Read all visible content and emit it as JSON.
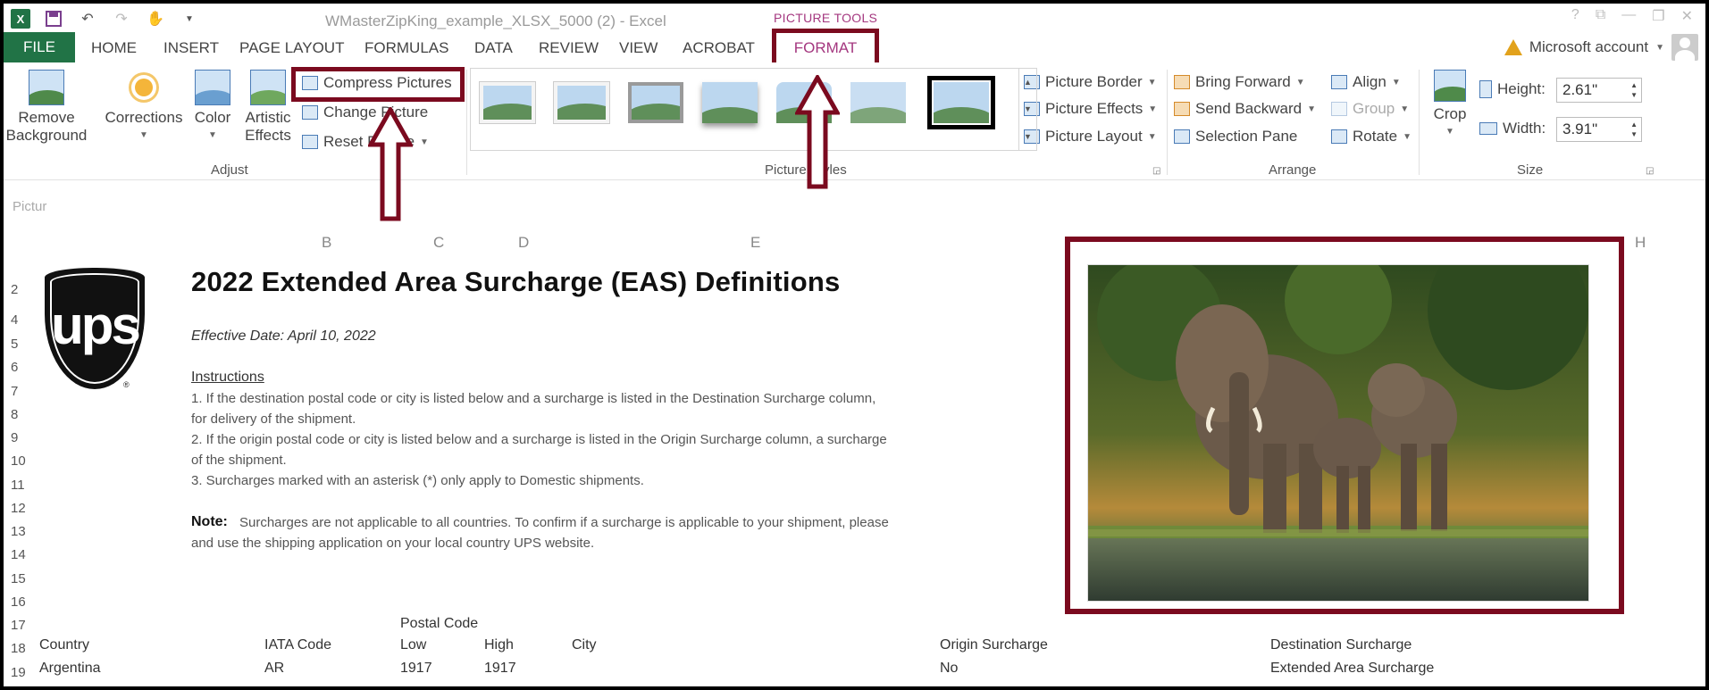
{
  "titlebar": {
    "app_icon": "excel-icon",
    "document_title": "WMasterZipKing_example_XLSX_5000 (2) - Excel",
    "context_title": "PICTURE TOOLS",
    "qat": [
      "save-icon",
      "undo-icon",
      "redo-icon",
      "touch-mode-icon",
      "customize-icon"
    ],
    "window": [
      "help-icon",
      "ribbon-display-icon",
      "minimize-icon",
      "restore-icon",
      "close-icon"
    ]
  },
  "tabs": {
    "file": "FILE",
    "items": [
      "HOME",
      "INSERT",
      "PAGE LAYOUT",
      "FORMULAS",
      "DATA",
      "REVIEW",
      "VIEW",
      "ACROBAT"
    ],
    "active": "FORMAT",
    "account": "Microsoft account"
  },
  "ribbon": {
    "adjust": {
      "label": "Adjust",
      "remove_background_1": "Remove",
      "remove_background_2": "Background",
      "corrections": "Corrections",
      "color": "Color",
      "artistic_1": "Artistic",
      "artistic_2": "Effects",
      "compress": "Compress Pictures",
      "change": "Change Picture",
      "reset": "Reset Picture"
    },
    "styles": {
      "label": "Picture Styles",
      "border": "Picture Border",
      "effects": "Picture Effects",
      "layout": "Picture Layout"
    },
    "arrange": {
      "label": "Arrange",
      "bring_forward": "Bring Forward",
      "send_backward": "Send Backward",
      "selection_pane": "Selection Pane",
      "align": "Align",
      "group": "Group",
      "rotate": "Rotate"
    },
    "size": {
      "label": "Size",
      "crop": "Crop",
      "height_label": "Height:",
      "height_value": "2.61\"",
      "width_label": "Width:",
      "width_value": "3.91\""
    }
  },
  "sheet": {
    "name_box": "Pictur",
    "columns": [
      "B",
      "C",
      "D",
      "E",
      "H"
    ],
    "rows": [
      "2",
      "4",
      "5",
      "6",
      "7",
      "8",
      "9",
      "10",
      "11",
      "12",
      "13",
      "14",
      "15",
      "16",
      "17",
      "18",
      "19"
    ],
    "heading": "2022 Extended Area Surcharge (EAS) Definitions",
    "effective": "Effective Date: April 10, 2022",
    "instructions_label": "Instructions",
    "line1": "1. If the destination postal code or city is listed below and a surcharge is listed in the Destination Surcharge column,",
    "line1b": "for delivery of the shipment.",
    "line2": "2. If the origin postal code or city is listed below and a surcharge is listed in the Origin Surcharge column, a surcharge",
    "line2b": "of the shipment.",
    "line3": "3. Surcharges marked with an asterisk (*) only apply to Domestic shipments.",
    "note_label": "Note:",
    "note_text": "Surcharges are not applicable to all countries. To confirm if a surcharge is applicable to your shipment, please",
    "note_text2": "and use the shipping application on your local country UPS website.",
    "postal_code": "Postal Code",
    "table_headers": [
      "Country",
      "IATA Code",
      "Low",
      "High",
      "City",
      "Origin Surcharge",
      "Destination Surcharge"
    ],
    "row1": [
      "Argentina",
      "AR",
      "1917",
      "1917",
      "",
      "No",
      "Extended Area Surcharge"
    ],
    "logo_text": "ups",
    "logo_reg": "®"
  },
  "colors": {
    "excel_green": "#217346",
    "highlight": "#7b0a1f",
    "context_pink": "#a4377f"
  }
}
